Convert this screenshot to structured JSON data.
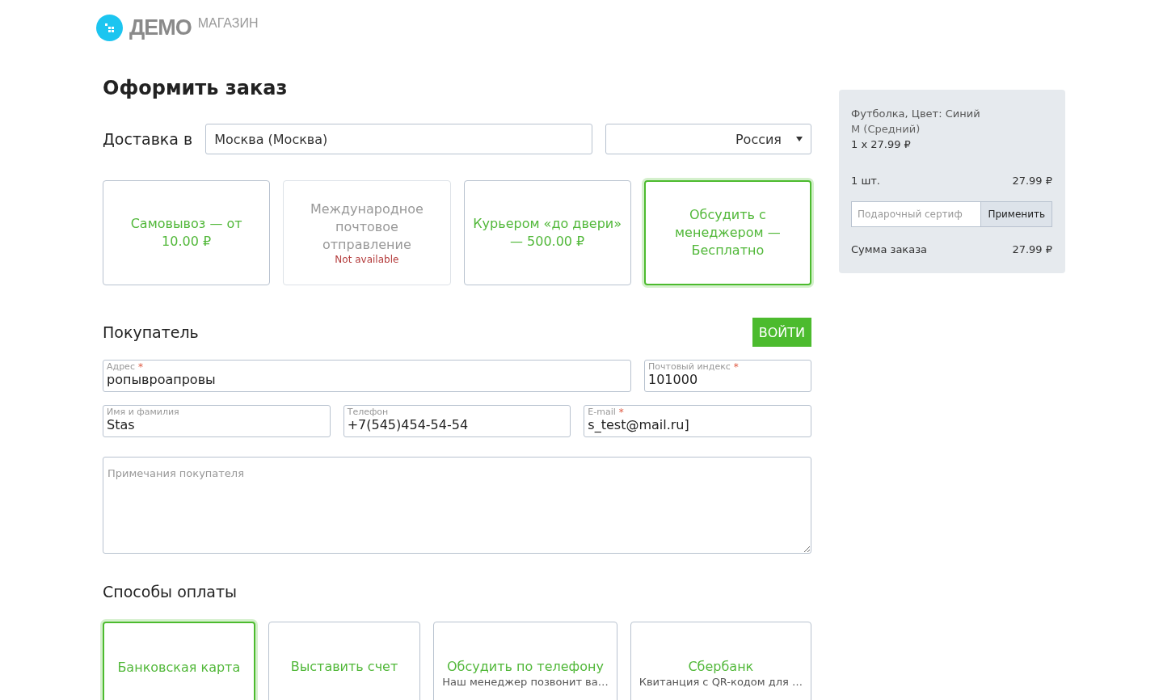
{
  "logo": {
    "brand": "ДЕМО",
    "sub": "МАГАЗИН"
  },
  "title": "Оформить заказ",
  "delivery": {
    "label": "Доставка в",
    "city": "Москва (Москва)",
    "country": "Россия"
  },
  "shipping_options": [
    {
      "label": "Самовывоз — от 10.00 ₽",
      "selected": false,
      "disabled": false
    },
    {
      "label": "Международное почтовое отправление",
      "selected": false,
      "disabled": true,
      "note": "Not available"
    },
    {
      "label": "Курьером «до двери» — 500.00 ₽",
      "selected": false,
      "disabled": false
    },
    {
      "label": "Обсудить с менеджером — Бесплатно",
      "selected": true,
      "disabled": false
    }
  ],
  "buyer": {
    "heading": "Покупатель",
    "login": "ВОЙТИ",
    "fields": [
      {
        "label": "Адрес",
        "required_mark": "*",
        "value": "ропывроапровы"
      },
      {
        "label": "Почтовый индекс",
        "required_mark": "*",
        "value": "101000"
      },
      {
        "label": "Имя и фамилия",
        "value": "Stas"
      },
      {
        "label": "Телефон",
        "value": "+7(545)454-54-54"
      },
      {
        "label": "E-mail",
        "required_mark": "*",
        "value": "s_test@mail.ru]"
      }
    ],
    "notes_placeholder": "Примечания покупателя"
  },
  "payment": {
    "heading": "Способы оплаты",
    "options": [
      {
        "label": "Банковская карта",
        "selected": true
      },
      {
        "label": "Выставить счет",
        "selected": false
      },
      {
        "label": "Обсудить по телефону",
        "description": "Наш менеджер позвонит ва…",
        "selected": false
      },
      {
        "label": "Сбербанк",
        "description": "Квитанция с QR-кодом для …",
        "selected": false
      }
    ]
  },
  "cart": {
    "item": {
      "name": "Футболка, Цвет: Синий",
      "variant": "M (Средний)",
      "qty_price": "1 x 27.99 ₽"
    },
    "count": "1 шт.",
    "subtotal": "27.99 ₽",
    "coupon_placeholder": "Подарочный сертиф",
    "apply": "Применить",
    "total_label": "Сумма заказа",
    "total": "27.99 ₽"
  }
}
